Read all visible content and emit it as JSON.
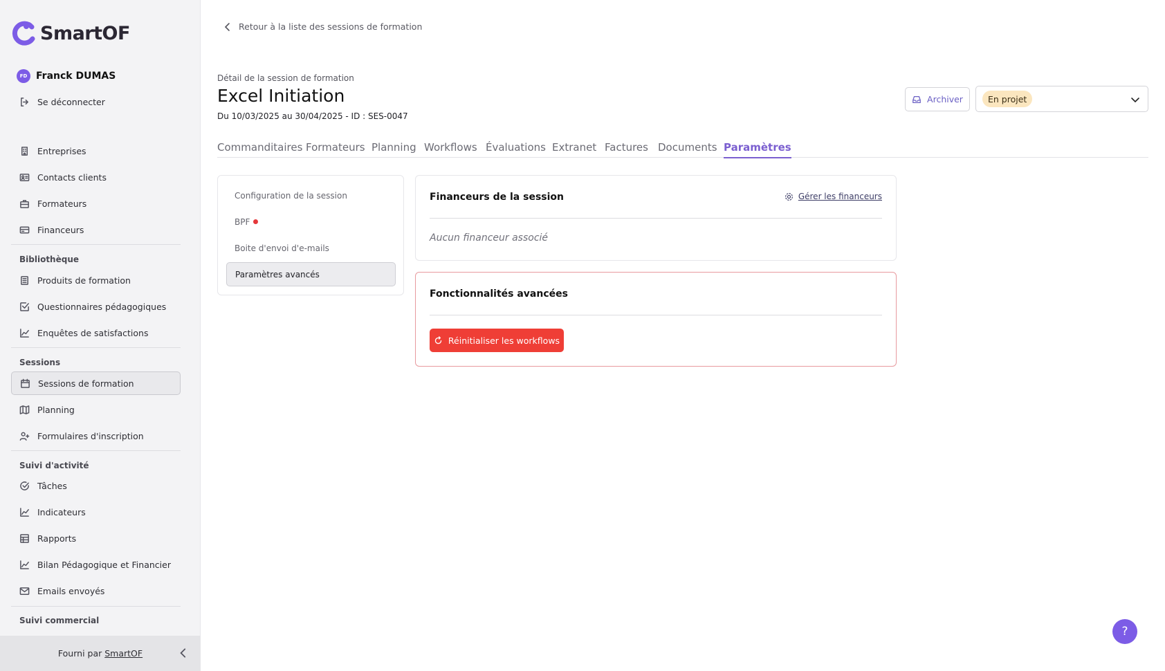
{
  "brand": {
    "name": "SmartOF",
    "accent": "#7c5ce6"
  },
  "user": {
    "initials": "FD",
    "name": "Franck DUMAS",
    "logout": "Se déconnecter"
  },
  "nav": {
    "main": [
      "Entreprises",
      "Contacts clients",
      "Formateurs",
      "Financeurs"
    ],
    "bibliotheque": {
      "title": "Bibliothèque",
      "items": [
        "Produits de formation",
        "Questionnaires pédagogiques",
        "Enquêtes de satisfactions"
      ]
    },
    "sessions": {
      "title": "Sessions",
      "items": [
        "Sessions de formation",
        "Planning",
        "Formulaires d'inscription"
      ]
    },
    "suivi": {
      "title": "Suivi d'activité",
      "items": [
        "Tâches",
        "Indicateurs",
        "Rapports",
        "Bilan Pédagogique et Financier",
        "Emails envoyés"
      ]
    },
    "commercial": {
      "title": "Suivi commercial"
    }
  },
  "footer": {
    "prefix": "Fourni par",
    "link": "SmartOF"
  },
  "page": {
    "back": "Retour à la liste des sessions de formation",
    "subtitle": "Détail de la session de formation",
    "title": "Excel Initiation",
    "dates": "Du 10/03/2025 au 30/04/2025 - ID : SES-0047",
    "archive": "Archiver",
    "status": "En projet"
  },
  "tabs": [
    "Commanditaires",
    "Formateurs",
    "Planning",
    "Workflows",
    "Évaluations",
    "Extranet",
    "Factures",
    "Documents",
    "Paramètres"
  ],
  "active_tab": "Paramètres",
  "subnav": [
    "Configuration de la session",
    "BPF",
    "Boite d'envoi d'e-mails",
    "Paramètres avancés"
  ],
  "financeurs": {
    "title": "Financeurs de la session",
    "manage": "Gérer les financeurs",
    "empty": "Aucun financeur associé"
  },
  "advanced": {
    "title": "Fonctionnalités avancées",
    "reset": "Réinitialiser les workflows"
  },
  "help": "?"
}
